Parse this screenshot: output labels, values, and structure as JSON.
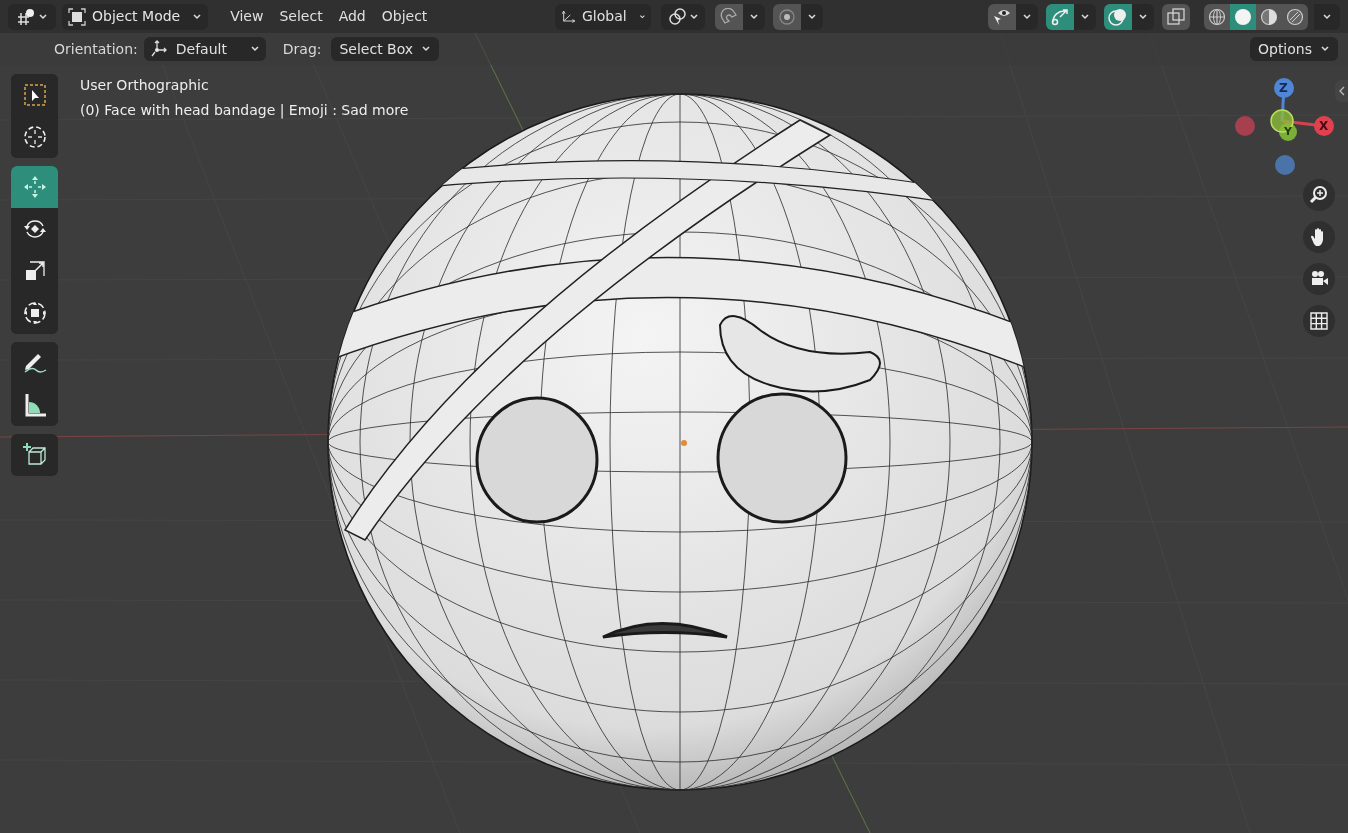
{
  "header": {
    "mode": "Object Mode",
    "menus": [
      "View",
      "Select",
      "Add",
      "Object"
    ],
    "orientation": "Global",
    "toggles": [
      {
        "kind": "snap",
        "on": false
      },
      {
        "kind": "proportional",
        "on": false
      }
    ],
    "right_toggles": [
      {
        "kind": "visibility",
        "on": false
      },
      {
        "kind": "gizmo",
        "on": true
      },
      {
        "kind": "overlay",
        "on": true
      },
      {
        "kind": "xray",
        "on": false
      }
    ],
    "shading": [
      {
        "kind": "wireframe",
        "selected": false
      },
      {
        "kind": "solid",
        "selected": true
      },
      {
        "kind": "material",
        "selected": false
      },
      {
        "kind": "rendered",
        "selected": false
      }
    ]
  },
  "tool_settings": {
    "orientation_label": "Orientation:",
    "orientation": "Default",
    "drag_label": "Drag:",
    "drag": "Select Box",
    "options": "Options"
  },
  "viewport": {
    "view_name": "User Orthographic",
    "object_info": "(0) Face with head bandage | Emoji : Sad more"
  },
  "tool_groups": [
    [
      {
        "kind": "select_box",
        "selected": false
      },
      {
        "kind": "cursor",
        "selected": false
      }
    ],
    [
      {
        "kind": "move",
        "selected": true
      },
      {
        "kind": "rotate",
        "selected": false
      },
      {
        "kind": "scale",
        "selected": false
      },
      {
        "kind": "transform",
        "selected": false
      }
    ],
    [
      {
        "kind": "annotate",
        "selected": false
      },
      {
        "kind": "measure",
        "selected": false
      }
    ],
    [
      {
        "kind": "add_cube",
        "selected": false
      }
    ]
  ],
  "axis_labels": {
    "z": "Z",
    "y": "Y",
    "x": "X"
  },
  "nav_buttons": [
    {
      "kind": "zoom"
    },
    {
      "kind": "pan"
    },
    {
      "kind": "camera"
    },
    {
      "kind": "ortho_grid"
    }
  ]
}
